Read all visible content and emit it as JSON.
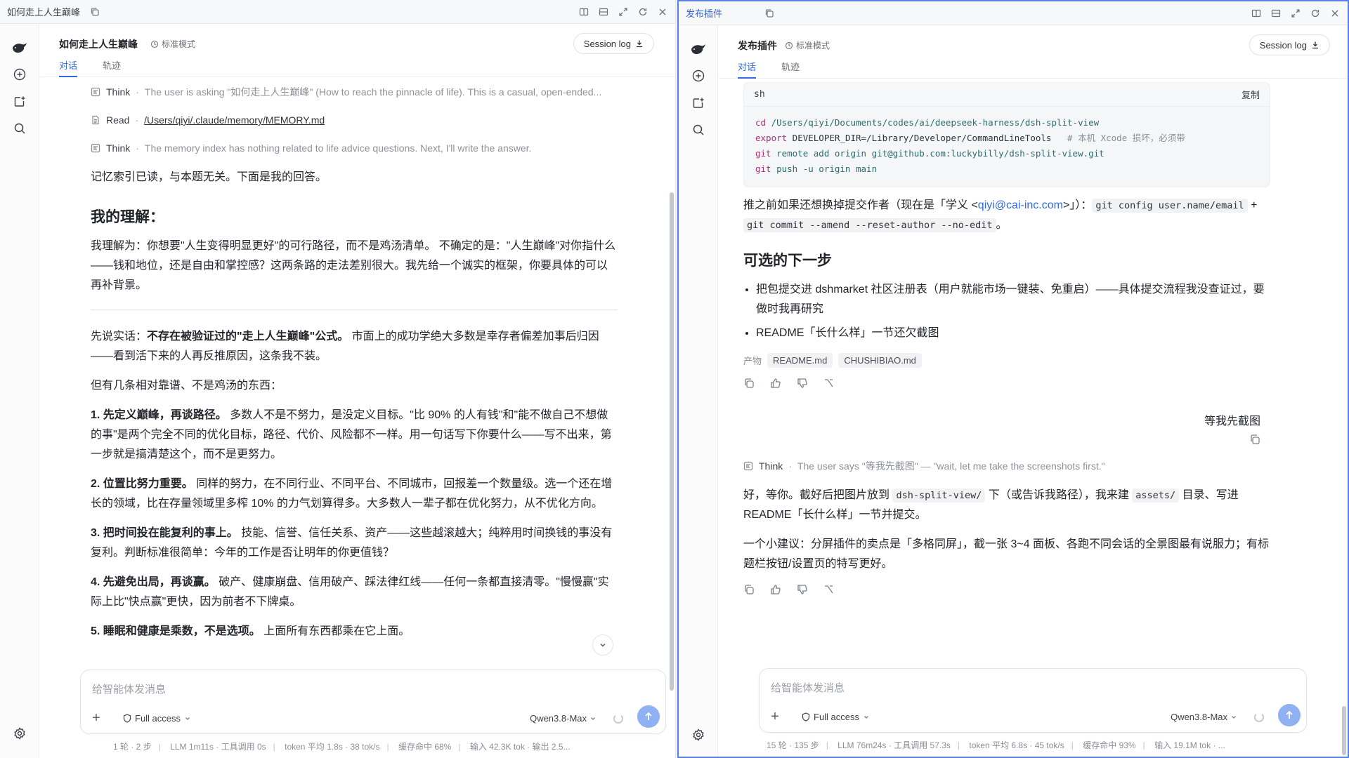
{
  "left": {
    "window_title": "如何走上人生巅峰",
    "chat_title": "如何走上人生巅峰",
    "mode": "标准模式",
    "tabs": [
      "对话",
      "轨迹"
    ],
    "session_log": "Session log",
    "tools": [
      {
        "kind": "Think",
        "detail": "The user is asking \"如何走上人生巅峰\" (How to reach the pinnacle of life). This is a casual, open-ended..."
      },
      {
        "kind": "Read",
        "detail": "/Users/qiyi/.claude/memory/MEMORY.md"
      },
      {
        "kind": "Think",
        "detail": "The memory index has nothing related to life advice questions. Next, I'll write the answer."
      }
    ],
    "intro": "记忆索引已读，与本题无关。下面是我的回答。",
    "section_title": "我的理解：",
    "understanding": "我理解为：你想要\"人生变得明显更好\"的可行路径，而不是鸡汤清单。 不确定的是：\"人生巅峰\"对你指什么——钱和地位，还是自由和掌控感？这两条路的走法差别很大。我先给一个诚实的框架，你要具体的可以再补背景。",
    "truth_prefix": "先说实话：",
    "truth_bold": "不存在被验证过的\"走上人生巅峰\"公式。",
    "truth_rest": " 市面上的成功学绝大多数是幸存者偏差加事后归因——看到活下来的人再反推原因，这条我不装。",
    "reliable": "但有几条相对靠谱、不是鸡汤的东西：",
    "points": [
      {
        "title": "1. 先定义巅峰，再谈路径。",
        "text": " 多数人不是不努力，是没定义目标。\"比 90% 的人有钱\"和\"能不做自己不想做的事\"是两个完全不同的优化目标，路径、代价、风险都不一样。用一句话写下你要什么——写不出来，第一步就是搞清楚这个，而不是更努力。"
      },
      {
        "title": "2. 位置比努力重要。",
        "text": " 同样的努力，在不同行业、不同平台、不同城市，回报差一个数量级。选一个还在增长的领域，比在存量领域里多榨 10% 的力气划算得多。大多数人一辈子都在优化努力，从不优化方向。"
      },
      {
        "title": "3. 把时间投在能复利的事上。",
        "text": " 技能、信誉、信任关系、资产——这些越滚越大；纯粹用时间换钱的事没有复利。判断标准很简单：今年的工作是否让明年的你更值钱？"
      },
      {
        "title": "4. 先避免出局，再谈赢。",
        "text": " 破产、健康崩盘、信用破产、踩法律红线——任何一条都直接清零。\"慢慢赢\"实际上比\"快点赢\"更快，因为前者不下牌桌。"
      },
      {
        "title": "5. 睡眠和健康是乘数，不是选项。",
        "text": " 上面所有东西都乘在它上面。"
      }
    ],
    "composer_placeholder": "给智能体发消息",
    "access": "Full access",
    "model": "Qwen3.8-Max",
    "status": [
      "1 轮 · 2 步",
      "LLM 1m11s · 工具调用 0s",
      "token 平均 1.8s · 38 tok/s",
      "缓存命中 68%",
      "输入 42.3K tok · 输出 2.5..."
    ]
  },
  "right": {
    "window_title": "发布插件",
    "chat_title": "发布插件",
    "mode": "标准模式",
    "tabs": [
      "对话",
      "轨迹"
    ],
    "session_log": "Session log",
    "code": {
      "lang": "sh",
      "copy_label": "复制",
      "lines": [
        {
          "cmd": "cd",
          "rest": " /Users/qiyi/Documents/codes/ai/deepseek-harness/dsh-split-view",
          "comment": ""
        },
        {
          "cmd": "export",
          "rest": " DEVELOPER_DIR=/Library/Developer/CommandLineTools",
          "comment": "   # 本机 Xcode 损坏，必须带"
        },
        {
          "cmd": "git",
          "rest": " remote add origin git@github.com:luckybilly/dsh-split-view.git",
          "comment": ""
        },
        {
          "cmd": "git",
          "rest": " push -u origin main",
          "comment": ""
        }
      ]
    },
    "author_note_1": "推之前如果还想换掉提交作者（现在是「学义 <",
    "author_email": "qiyi@cai-inc.com",
    "author_note_2": ">」）：",
    "author_code_1": "git config user.name/email",
    "author_plus": " + ",
    "author_code_2": "git commit --amend --reset-author --no-edit",
    "author_end": "。",
    "next_title": "可选的下一步",
    "next_items": [
      "把包提交进 dshmarket 社区注册表（用户就能市场一键装、免重启）——具体提交流程我没查证过，要做时我再研究",
      "README「长什么样」一节还欠截图"
    ],
    "artifacts_label": "产物",
    "artifacts": [
      "README.md",
      "CHUSHIBIAO.md"
    ],
    "user_message": "等我先截图",
    "think_label": "Think",
    "think_detail": "The user says \"等我先截图\" — \"wait, let me take the screenshots first.\"",
    "reply1_a": "好，等你。截好后把图片放到 ",
    "reply1_code1": "dsh-split-view/",
    "reply1_b": " 下（或告诉我路径），我来建 ",
    "reply1_code2": "assets/",
    "reply1_c": " 目录、写进 README「长什么样」一节并提交。",
    "reply2": "一个小建议：分屏插件的卖点是「多格同屏」，截一张 3~4 面板、各跑不同会话的全景图最有说服力；有标题栏按钮/设置页的特写更好。",
    "composer_placeholder": "给智能体发消息",
    "access": "Full access",
    "model": "Qwen3.8-Max",
    "status": [
      "15 轮 · 135 步",
      "LLM 76m24s · 工具调用 57.3s",
      "token 平均 6.8s · 45 tok/s",
      "缓存命中 93%",
      "输入 19.1M tok · ..."
    ]
  }
}
